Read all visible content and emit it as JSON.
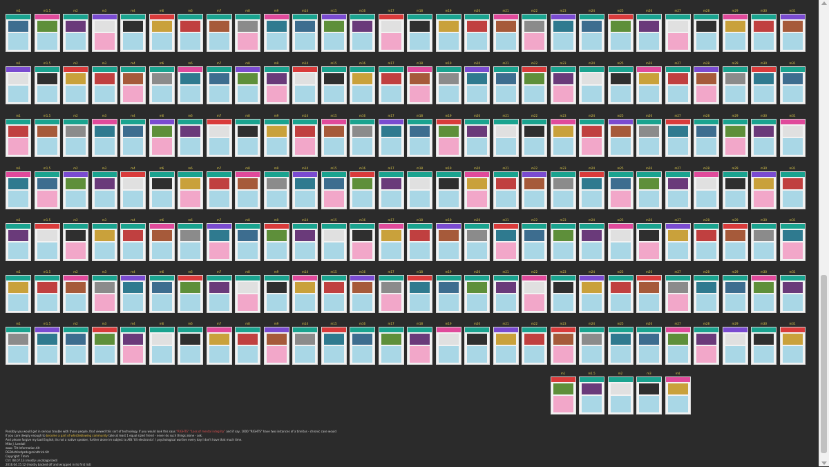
{
  "footer": {
    "para1a": "Possibly you would get in serious trouble with those people, that viewed this sort of technology. If you would look this says",
    "para1b": "\"RIGHTS\" \"Loss of mental integrity\"",
    "para1c": "and if say, 1000 \"RIGHTS\" have two instances of a tinnitus - chronic case would",
    "para2a": "If you care deeply enough to",
    "para2b": "become a part of whistleblowing community",
    "para2c": "take at least 1 equal sized friend - never do such things alone - ask.",
    "para3": "And please forgive my bad English; its not a native speaker, further alone im subject to ABt 'tilt electronics' / psychological warfare every day I don't have that much time.",
    "lines": [
      "Mike J. Leedall",
      "www. Tilt-Information.tilt",
      "DSDAshfordpzdc@mindtrick.tilt",
      "Copyright: Tmrm",
      "Ctrl: 08.07.13 (mostly uncatagorized)",
      "2016.04.15.12 (mostly backed off and wrapped in its first list)"
    ]
  },
  "cards": [
    {
      "id": "m1",
      "l": "m1"
    },
    {
      "id": "m2",
      "l": "m1.5"
    },
    {
      "id": "m3",
      "l": "m2"
    },
    {
      "id": "m4",
      "l": "m3"
    },
    {
      "id": "m5",
      "l": "m4"
    },
    {
      "id": "m6",
      "l": "m6"
    },
    {
      "id": "m7",
      "l": "m6"
    },
    {
      "id": "m8",
      "l": "m7"
    },
    {
      "id": "m9",
      "l": "m8"
    },
    {
      "id": "m10",
      "l": "m9"
    },
    {
      "id": "m11",
      "l": "m14"
    },
    {
      "id": "m12",
      "l": "m15"
    },
    {
      "id": "m13",
      "l": "m16"
    },
    {
      "id": "m14",
      "l": "m17"
    },
    {
      "id": "m15",
      "l": "m18"
    },
    {
      "id": "m16",
      "l": "m19"
    },
    {
      "id": "m17",
      "l": "m20"
    },
    {
      "id": "m18",
      "l": "m21"
    },
    {
      "id": "m19",
      "l": "m22"
    },
    {
      "id": "m20",
      "l": "m23"
    },
    {
      "id": "m21",
      "l": "m24"
    },
    {
      "id": "m22",
      "l": "m25"
    },
    {
      "id": "m23",
      "l": "m26"
    },
    {
      "id": "m24",
      "l": "m27"
    },
    {
      "id": "m25",
      "l": "m28"
    },
    {
      "id": "m26",
      "l": "m29"
    },
    {
      "id": "m27",
      "l": "m30"
    },
    {
      "id": "m28",
      "l": "m31"
    }
  ]
}
